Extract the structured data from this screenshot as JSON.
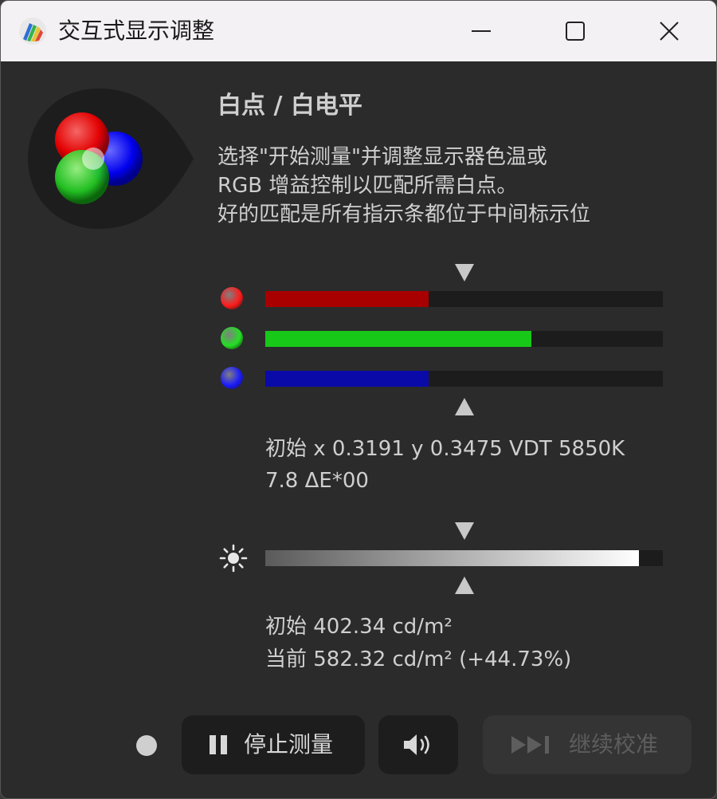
{
  "window": {
    "title": "交互式显示调整",
    "controls": {
      "minimize": "minimize-icon",
      "maximize": "maximize-icon",
      "close": "close-icon"
    }
  },
  "section": {
    "heading": "白点 / 白电平",
    "description": [
      "选择\"开始测量\"并调整显示器色温或",
      "RGB 增益控制以匹配所需白点。",
      "好的匹配是所有指示条都位于中间标示位"
    ]
  },
  "rgb_bars": [
    {
      "channel": "red",
      "color": "#ff1a1a",
      "fill_color": "#a80000",
      "level": 0.41
    },
    {
      "channel": "green",
      "color": "#22e022",
      "fill_color": "#18c818",
      "level": 0.67
    },
    {
      "channel": "blue",
      "color": "#1a1aff",
      "fill_color": "#0a0aa8",
      "level": 0.41
    }
  ],
  "white_point": {
    "line1": "初始 x 0.3191 y 0.3475 VDT 5850K",
    "line2": "7.8 ΔE*00"
  },
  "luminance_bar": {
    "icon": "brightness-icon",
    "level": 0.94
  },
  "luminance": {
    "initial": "初始 402.34 cd/m²",
    "current": "当前 582.32 cd/m² (+44.73%)"
  },
  "footer": {
    "stop_button": {
      "icon": "pause-icon",
      "label": "停止测量"
    },
    "sound_button": {
      "icon": "speaker-icon"
    },
    "continue_button": {
      "icon": "skip-forward-icon",
      "label": "继续校准",
      "disabled": true
    }
  },
  "colors": {
    "background": "#2b2b2b",
    "titlebar": "#f3f1f3",
    "text": "#cfcfcf",
    "disabled_text": "#5d5d5d"
  }
}
